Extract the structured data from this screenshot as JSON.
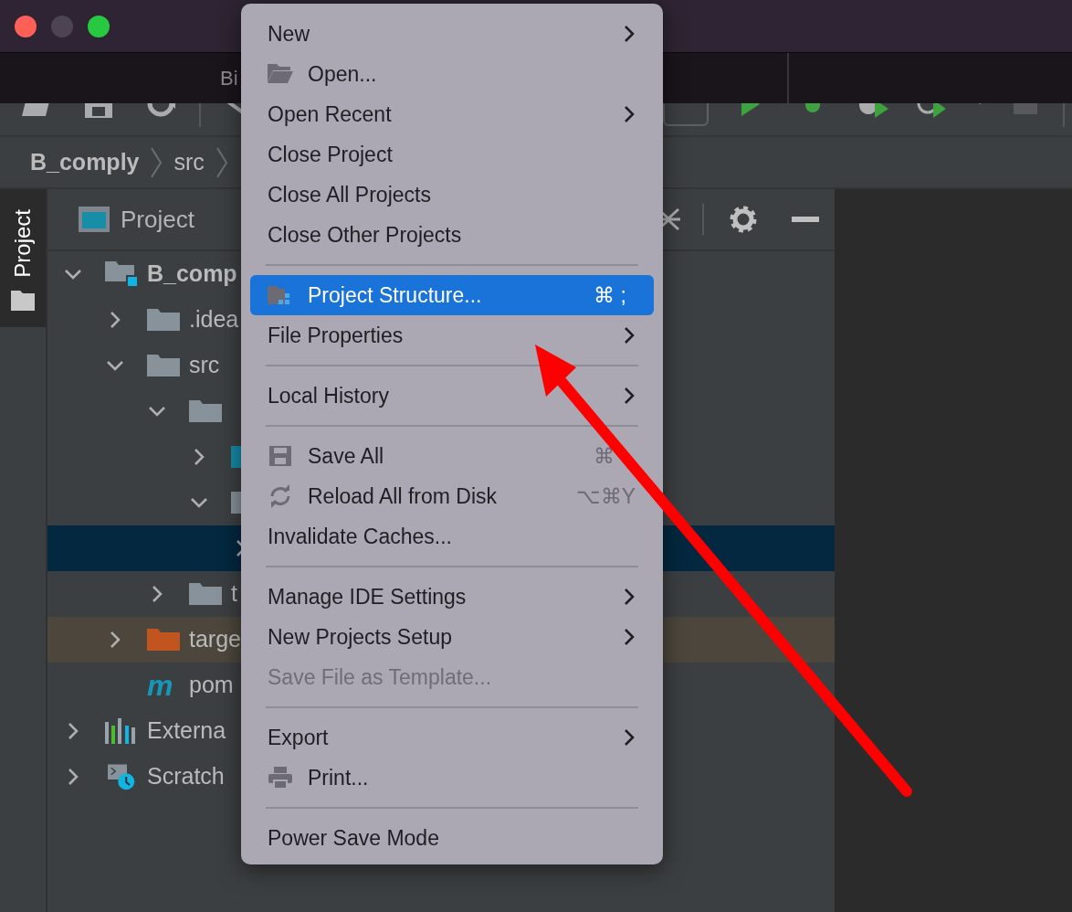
{
  "editor_tab": {
    "label": "Bi"
  },
  "breadcrumbs": [
    "B_comply",
    "src"
  ],
  "side_tab": {
    "label": "Project",
    "selected": true
  },
  "project_panel": {
    "view_selector": "Project",
    "tree": [
      {
        "kind": "module",
        "label": "B_comp",
        "expanded": true,
        "selected": false,
        "excluded": false,
        "children": [
          {
            "kind": "folder",
            "label": ".idea",
            "expanded": false,
            "selected": false,
            "excluded": false
          },
          {
            "kind": "folder",
            "label": "src",
            "expanded": true,
            "selected": false,
            "excluded": false,
            "children": [
              {
                "kind": "folder",
                "expanded": true,
                "selected": false,
                "excluded": false,
                "children": [
                  {
                    "kind": "source",
                    "expanded": false,
                    "selected": false,
                    "excluded": false
                  },
                  {
                    "kind": "folder",
                    "expanded": true,
                    "selected": false,
                    "excluded": false,
                    "children": [
                      {
                        "expanded": false,
                        "selected": true,
                        "excluded": false
                      }
                    ]
                  }
                ]
              },
              {
                "kind": "folder",
                "label": "t",
                "expanded": false,
                "selected": false,
                "excluded": false
              }
            ]
          },
          {
            "kind": "output",
            "label": "targe",
            "expanded": false,
            "selected": false,
            "excluded": true
          },
          {
            "kind": "maven",
            "badge": "m",
            "label": "pom",
            "selected": false,
            "excluded": false
          }
        ]
      },
      {
        "kind": "library",
        "label": "Externa",
        "expanded": false,
        "selected": false,
        "excluded": false
      },
      {
        "kind": "scratch",
        "label": "Scratch",
        "expanded": false,
        "selected": false,
        "excluded": false
      }
    ]
  },
  "menu": {
    "items": [
      {
        "kind": "item",
        "label": "New",
        "submenu": true,
        "selected": false,
        "disabled": false
      },
      {
        "kind": "item",
        "label": "Open...",
        "selected": false,
        "disabled": false
      },
      {
        "kind": "item",
        "label": "Open Recent",
        "submenu": true,
        "selected": false,
        "disabled": false
      },
      {
        "kind": "item",
        "label": "Close Project",
        "selected": false,
        "disabled": false
      },
      {
        "kind": "item",
        "label": "Close All Projects",
        "selected": false,
        "disabled": false
      },
      {
        "kind": "item",
        "label": "Close Other Projects",
        "selected": false,
        "disabled": false
      },
      {
        "kind": "separator"
      },
      {
        "kind": "item",
        "label": "Project Structure...",
        "shortcut": "⌘ ;",
        "selected": true,
        "disabled": false
      },
      {
        "kind": "item",
        "label": "File Properties",
        "submenu": true,
        "selected": false,
        "disabled": false
      },
      {
        "kind": "separator"
      },
      {
        "kind": "item",
        "label": "Local History",
        "submenu": true,
        "selected": false,
        "disabled": false
      },
      {
        "kind": "separator"
      },
      {
        "kind": "item",
        "label": "Save All",
        "shortcut": "⌘",
        "selected": false,
        "disabled": false
      },
      {
        "kind": "item",
        "label": "Reload All from Disk",
        "shortcut": "⌥⌘Y",
        "selected": false,
        "disabled": false
      },
      {
        "kind": "item",
        "label": "Invalidate Caches...",
        "selected": false,
        "disabled": false
      },
      {
        "kind": "separator"
      },
      {
        "kind": "item",
        "label": "Manage IDE Settings",
        "submenu": true,
        "selected": false,
        "disabled": false
      },
      {
        "kind": "item",
        "label": "New Projects Setup",
        "submenu": true,
        "selected": false,
        "disabled": false
      },
      {
        "kind": "item",
        "label": "Save File as Template...",
        "selected": false,
        "disabled": true
      },
      {
        "kind": "separator"
      },
      {
        "kind": "item",
        "label": "Export",
        "submenu": true,
        "selected": false,
        "disabled": false
      },
      {
        "kind": "item",
        "label": "Print...",
        "selected": false,
        "disabled": false
      },
      {
        "kind": "separator"
      },
      {
        "kind": "item",
        "label": "Power Save Mode",
        "selected": false,
        "disabled": false
      }
    ]
  }
}
